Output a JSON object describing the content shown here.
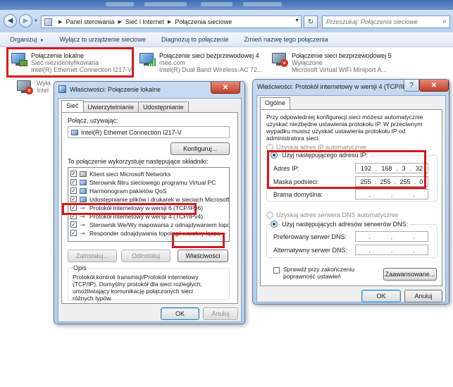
{
  "explorer": {
    "breadcrumb": [
      "Panel sterowania",
      "Sieć i Internet",
      "Połączenia sieciowe"
    ],
    "search_placeholder": "Przeszukaj: Połączenia sieciowe",
    "toolbar": {
      "organize": "Organizuj",
      "disable": "Wyłącz to urządzenie sieciowe",
      "diagnose": "Diagnozuj to połączenie",
      "rename": "Zmień nazwę tego połączenia"
    },
    "connections": [
      {
        "name": "Połączenie lokalne",
        "status": "Sieć niezidentyfikowana",
        "device": "Intel(R) Ethernet Connection I217-V"
      },
      {
        "name": "Połączenie sieci bezprzewodowej 4",
        "status": "mee.com",
        "device": "Intel(R) Dual Band Wireless-AC 72..."
      },
      {
        "name": "Połączenie sieci bezprzewodowej 5",
        "status": "Wyłączone",
        "device": "Microsoft Virtual WiFi Miniport A..."
      },
      {
        "name": "",
        "status": "Wyła",
        "device": "Intel"
      }
    ]
  },
  "props_dialog": {
    "title": "Właściwości: Połączenie lokalne",
    "tabs": [
      "Sieć",
      "Uwierzytelnianie",
      "Udostępnianie"
    ],
    "connect_using_label": "Połącz, używając:",
    "adapter": "Intel(R) Ethemet Connection I217-V",
    "configure_button": "Konfiguruj...",
    "components_label": "To połączenie wykorzystuje następujące składniki:",
    "components": [
      {
        "label": "Klient sieci Microsoft Networks",
        "checked": true
      },
      {
        "label": "Sterownik filtru sieciowego programu Virtual PC",
        "checked": true
      },
      {
        "label": "Harmonogram pakietów QoS",
        "checked": true
      },
      {
        "label": "Udostępnianie plików i drukarek w sieciach Microsoft N...",
        "checked": true
      },
      {
        "label": "Protokół internetowy w wersji 6 (TCP/IPv6)",
        "checked": true
      },
      {
        "label": "Protokół internetowy w wersji 4 (TCP/IPv4)",
        "checked": true
      },
      {
        "label": "Sterownik We/Wy mapowania z odnajdywaniem topolo...",
        "checked": true
      },
      {
        "label": "Responder odnajdywania topologii warstwy łącza",
        "checked": true
      }
    ],
    "install_button": "Zainstaluj...",
    "uninstall_button": "Odinstaluj",
    "properties_button": "Właściwości",
    "description_group": "Opis",
    "description": "Protokół kontroli transmisji/Protokół internetowy (TCP/IP). Domyślny protokół dla sieci rozległych, umożliwiający komunikację połączonych sieci różnych typów.",
    "ok_button": "OK",
    "cancel_button": "Anuluj"
  },
  "ipv4_dialog": {
    "title": "Właściwości: Protokół internetowy w wersji 4 (TCP/IPv4)",
    "tab": "Ogólne",
    "intro": "Przy odpowiedniej konfiguracji sieci możesz automatycznie uzyskać niezbędne ustawienia protokołu IP. W przeciwnym wypadku musisz uzyskać ustawienia protokołu IP od administratora sieci.",
    "auto_ip": "Uzyskaj adres IP automatycznie",
    "manual_ip": "Użyj następującego adresu IP:",
    "ip_label": "Adres IP:",
    "ip": [
      "192",
      "168",
      "3",
      "32"
    ],
    "mask_label": "Maska podsieci:",
    "mask": [
      "255",
      "255",
      "255",
      "0"
    ],
    "gateway_label": "Brama domyślna:",
    "auto_dns": "Uzyskaj adres serwera DNS automatycznie",
    "manual_dns": "Użyj następujących adresów serwerów DNS:",
    "preferred_dns_label": "Preferowany serwer DNS:",
    "alternate_dns_label": "Alternatywny serwer DNS:",
    "validate_label": "Sprawdź przy zakończeniu poprawność ustawień",
    "advanced_button": "Zaawansowane...",
    "ok_button": "OK",
    "cancel_button": "Anuluj"
  },
  "colors": {
    "highlight": "#d7191c",
    "window_frame": "#b5cdec"
  }
}
